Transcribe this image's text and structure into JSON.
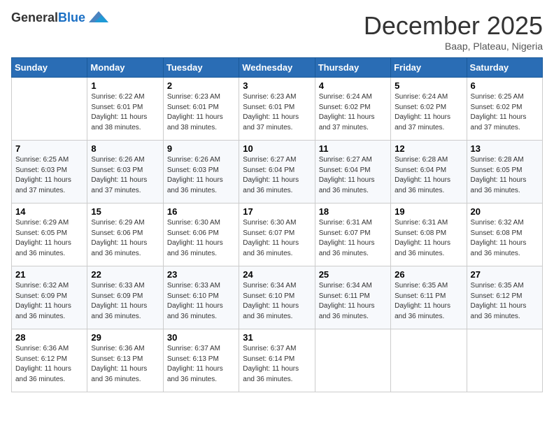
{
  "header": {
    "logo_line1": "General",
    "logo_line2": "Blue",
    "month": "December 2025",
    "location": "Baap, Plateau, Nigeria"
  },
  "days_of_week": [
    "Sunday",
    "Monday",
    "Tuesday",
    "Wednesday",
    "Thursday",
    "Friday",
    "Saturday"
  ],
  "weeks": [
    [
      {
        "day": "",
        "info": ""
      },
      {
        "day": "1",
        "info": "Sunrise: 6:22 AM\nSunset: 6:01 PM\nDaylight: 11 hours\nand 38 minutes."
      },
      {
        "day": "2",
        "info": "Sunrise: 6:23 AM\nSunset: 6:01 PM\nDaylight: 11 hours\nand 38 minutes."
      },
      {
        "day": "3",
        "info": "Sunrise: 6:23 AM\nSunset: 6:01 PM\nDaylight: 11 hours\nand 37 minutes."
      },
      {
        "day": "4",
        "info": "Sunrise: 6:24 AM\nSunset: 6:02 PM\nDaylight: 11 hours\nand 37 minutes."
      },
      {
        "day": "5",
        "info": "Sunrise: 6:24 AM\nSunset: 6:02 PM\nDaylight: 11 hours\nand 37 minutes."
      },
      {
        "day": "6",
        "info": "Sunrise: 6:25 AM\nSunset: 6:02 PM\nDaylight: 11 hours\nand 37 minutes."
      }
    ],
    [
      {
        "day": "7",
        "info": "Sunrise: 6:25 AM\nSunset: 6:03 PM\nDaylight: 11 hours\nand 37 minutes."
      },
      {
        "day": "8",
        "info": "Sunrise: 6:26 AM\nSunset: 6:03 PM\nDaylight: 11 hours\nand 37 minutes."
      },
      {
        "day": "9",
        "info": "Sunrise: 6:26 AM\nSunset: 6:03 PM\nDaylight: 11 hours\nand 36 minutes."
      },
      {
        "day": "10",
        "info": "Sunrise: 6:27 AM\nSunset: 6:04 PM\nDaylight: 11 hours\nand 36 minutes."
      },
      {
        "day": "11",
        "info": "Sunrise: 6:27 AM\nSunset: 6:04 PM\nDaylight: 11 hours\nand 36 minutes."
      },
      {
        "day": "12",
        "info": "Sunrise: 6:28 AM\nSunset: 6:04 PM\nDaylight: 11 hours\nand 36 minutes."
      },
      {
        "day": "13",
        "info": "Sunrise: 6:28 AM\nSunset: 6:05 PM\nDaylight: 11 hours\nand 36 minutes."
      }
    ],
    [
      {
        "day": "14",
        "info": "Sunrise: 6:29 AM\nSunset: 6:05 PM\nDaylight: 11 hours\nand 36 minutes."
      },
      {
        "day": "15",
        "info": "Sunrise: 6:29 AM\nSunset: 6:06 PM\nDaylight: 11 hours\nand 36 minutes."
      },
      {
        "day": "16",
        "info": "Sunrise: 6:30 AM\nSunset: 6:06 PM\nDaylight: 11 hours\nand 36 minutes."
      },
      {
        "day": "17",
        "info": "Sunrise: 6:30 AM\nSunset: 6:07 PM\nDaylight: 11 hours\nand 36 minutes."
      },
      {
        "day": "18",
        "info": "Sunrise: 6:31 AM\nSunset: 6:07 PM\nDaylight: 11 hours\nand 36 minutes."
      },
      {
        "day": "19",
        "info": "Sunrise: 6:31 AM\nSunset: 6:08 PM\nDaylight: 11 hours\nand 36 minutes."
      },
      {
        "day": "20",
        "info": "Sunrise: 6:32 AM\nSunset: 6:08 PM\nDaylight: 11 hours\nand 36 minutes."
      }
    ],
    [
      {
        "day": "21",
        "info": "Sunrise: 6:32 AM\nSunset: 6:09 PM\nDaylight: 11 hours\nand 36 minutes."
      },
      {
        "day": "22",
        "info": "Sunrise: 6:33 AM\nSunset: 6:09 PM\nDaylight: 11 hours\nand 36 minutes."
      },
      {
        "day": "23",
        "info": "Sunrise: 6:33 AM\nSunset: 6:10 PM\nDaylight: 11 hours\nand 36 minutes."
      },
      {
        "day": "24",
        "info": "Sunrise: 6:34 AM\nSunset: 6:10 PM\nDaylight: 11 hours\nand 36 minutes."
      },
      {
        "day": "25",
        "info": "Sunrise: 6:34 AM\nSunset: 6:11 PM\nDaylight: 11 hours\nand 36 minutes."
      },
      {
        "day": "26",
        "info": "Sunrise: 6:35 AM\nSunset: 6:11 PM\nDaylight: 11 hours\nand 36 minutes."
      },
      {
        "day": "27",
        "info": "Sunrise: 6:35 AM\nSunset: 6:12 PM\nDaylight: 11 hours\nand 36 minutes."
      }
    ],
    [
      {
        "day": "28",
        "info": "Sunrise: 6:36 AM\nSunset: 6:12 PM\nDaylight: 11 hours\nand 36 minutes."
      },
      {
        "day": "29",
        "info": "Sunrise: 6:36 AM\nSunset: 6:13 PM\nDaylight: 11 hours\nand 36 minutes."
      },
      {
        "day": "30",
        "info": "Sunrise: 6:37 AM\nSunset: 6:13 PM\nDaylight: 11 hours\nand 36 minutes."
      },
      {
        "day": "31",
        "info": "Sunrise: 6:37 AM\nSunset: 6:14 PM\nDaylight: 11 hours\nand 36 minutes."
      },
      {
        "day": "",
        "info": ""
      },
      {
        "day": "",
        "info": ""
      },
      {
        "day": "",
        "info": ""
      }
    ]
  ]
}
